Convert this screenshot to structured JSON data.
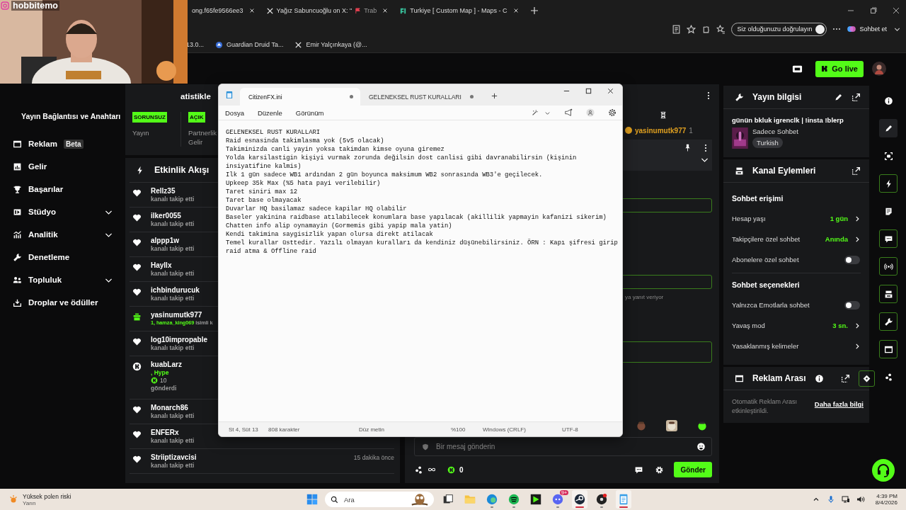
{
  "webcam": {
    "handle": "hobbitemo"
  },
  "browser": {
    "tabs": [
      {
        "title": "ong.f65fe9566ee3",
        "selected": false
      },
      {
        "title": "Yağız Sabuncuoğlu on X: \"",
        "title_end": "Trab",
        "selected": false
      },
      {
        "title": "Turkiye [ Custom Map ] - Maps - C",
        "selected": false
      }
    ],
    "verify": "Siz olduğunuzu doğrulayın",
    "copilot": "Sohbet et",
    "bookmarks": [
      "13.0...",
      "Guardian Druid Ta...",
      "Emir Yalçınkaya (@..."
    ]
  },
  "header": {
    "go_live": "Go live"
  },
  "sidebar": {
    "heading": "Yayın Bağlantısı ve Anahtarı",
    "items": [
      {
        "label": "Reklam",
        "badge": "Beta",
        "expandable": false
      },
      {
        "label": "Gelir",
        "expandable": false
      },
      {
        "label": "Başarılar",
        "expandable": false
      },
      {
        "label": "Stüdyo",
        "expandable": true
      },
      {
        "label": "Analitik",
        "expandable": true
      },
      {
        "label": "Denetleme",
        "expandable": false
      },
      {
        "label": "Topluluk",
        "expandable": true
      },
      {
        "label": "Droplar ve ödüller",
        "expandable": false
      }
    ]
  },
  "stats": {
    "title": "atistikle",
    "items": [
      {
        "badge": "SORUNSUZ",
        "label": "Yayın"
      },
      {
        "badge": "AÇIK",
        "label": "Partnerlik Gelir"
      }
    ]
  },
  "activity": {
    "title": "Etkinlik Akışı",
    "events": [
      {
        "kind": "follow",
        "user": "Rellz35",
        "detail": "kanalı takip etti"
      },
      {
        "kind": "follow",
        "user": "ilker0055",
        "detail": "kanalı takip etti"
      },
      {
        "kind": "follow",
        "user": "alppp1w",
        "detail": "kanalı takip etti"
      },
      {
        "kind": "follow",
        "user": "Hayllx",
        "detail": "kanalı takip etti"
      },
      {
        "kind": "follow",
        "user": "ichbindurucuk",
        "detail": "kanalı takip etti"
      },
      {
        "kind": "gift",
        "user": "yasinumutk977",
        "highlight": "1, hamza_king069",
        "detail": "isimli k"
      },
      {
        "kind": "follow",
        "user": "log10impropable",
        "detail": "kanalı takip etti"
      },
      {
        "kind": "kicks",
        "user": "kuabLarz",
        "highlight": ", Hype",
        "amount": "10",
        "detail": "gönderdi"
      },
      {
        "kind": "follow",
        "user": "Monarch86",
        "detail": "kanalı takip etti"
      },
      {
        "kind": "follow",
        "user": "ENFERx",
        "detail": "kanalı takip etti"
      },
      {
        "kind": "follow",
        "user": "Striiptizavcisi",
        "detail": "kanalı takip etti",
        "time": "15 dakika önce"
      }
    ]
  },
  "chat": {
    "pinned_user": "yasinumutk977",
    "pinned_count": "1",
    "typing": "ya yanıt veriyor",
    "placeholder": "Bir mesaj gönderin",
    "points": "0",
    "send": "Gönder"
  },
  "notepad": {
    "tabs": [
      {
        "title": "CitizenFX.ini",
        "selected": true,
        "unsaved": true
      },
      {
        "title": "GELENEKSEL RUST KURALLARI",
        "selected": false,
        "unsaved": true
      }
    ],
    "menus": [
      "Dosya",
      "Düzenle",
      "Görünüm"
    ],
    "lines": [
      "GELENEKSEL RUST KURALLARI",
      "Raid esnasinda takimlasma yok (5v5 olacak)",
      "Takiminizda canli yayin yoksa takimdan kimse oyuna giremez",
      "Yolda karsilastigin kişiyi vurmak zorunda değilsin dost canlisi gibi davranabilirsin (kişinin",
      "insiyatifine kalmis)",
      "Ilk 1 gün sadece WB1 ardından 2 gün boyunca maksimum WB2 sonrasında WB3'e geçilecek.",
      "Upkeep 35k Max (%5 hata payi verilebilir)",
      "Taret siniri max 12",
      "Taret base olmayacak",
      "Duvarlar HQ basilamaz sadece kapilar HQ olabilir",
      "Baseler yakinina raidbase atılabilecek konumlara base yapılacak (akillilik yapmayin kafanizi sikerim)",
      "Chatten info alip oynamayin (Gormemis gibi yapip mala yatin)",
      "Kendi takimina saygisizlik yapan olursa direkt atilacak",
      "Temel kurallar üsttedir. Yazılı olmayan kuralları da kendiniz düşünebilirsiniz. ÖRN : Kapı şifresi girip",
      "raid atma & Offline raid"
    ],
    "status": [
      "St 4, Süt 13",
      "808 karakter",
      "Düz metin",
      "%100",
      "Windows (CRLF)",
      "UTF-8"
    ]
  },
  "stream_info": {
    "title": "Yayın bilgisi",
    "stream_title": "günün bkluk igrenclk | !insta !blerp",
    "category": "Sadece Sohbet",
    "tag": "Turkish"
  },
  "channel_actions": {
    "title": "Kanal Eylemleri",
    "sections": [
      {
        "heading": "Sohbet erişimi",
        "rows": [
          {
            "kind": "value",
            "label": "Hesap yaşı",
            "value": "1 gün"
          },
          {
            "kind": "value",
            "label": "Takipçilere özel sohbet",
            "value": "Anında"
          },
          {
            "kind": "toggle",
            "label": "Abonelere özel sohbet",
            "on": false
          }
        ]
      },
      {
        "heading": "Sohbet seçenekleri",
        "rows": [
          {
            "kind": "toggle",
            "label": "Yalnızca Emotlarla sohbet",
            "on": false
          },
          {
            "kind": "value",
            "label": "Yavaş mod",
            "value": "3 sn."
          },
          {
            "kind": "link",
            "label": "Yasaklanmış kelimeler"
          }
        ]
      }
    ]
  },
  "ad_break": {
    "title": "Reklam Arası",
    "text": "Otomatik Reklam Arası etkinleştirildi.",
    "link": "Daha fazla bilgi"
  },
  "rail": {
    "icons": [
      {
        "selected": false,
        "pinned": false
      },
      {
        "selected": true,
        "pinned": false
      },
      {
        "selected": false,
        "pinned": false
      },
      {
        "selected": false,
        "pinned": true
      },
      {
        "selected": false,
        "pinned": false
      },
      {
        "selected": false,
        "pinned": true
      },
      {
        "selected": false,
        "pinned": true
      },
      {
        "selected": false,
        "pinned": true
      },
      {
        "selected": false,
        "pinned": true
      },
      {
        "selected": false,
        "pinned": true
      },
      {
        "selected": false,
        "pinned": false
      }
    ]
  },
  "taskbar": {
    "weather": "Yüksek polen riski",
    "weather_sub": "Yarın",
    "search": "Ara",
    "apps": [
      {
        "running": false,
        "selected": false
      },
      {
        "running": false,
        "selected": false
      },
      {
        "running": true,
        "selected": false
      },
      {
        "running": true,
        "selected": false
      },
      {
        "running": false,
        "selected": false
      },
      {
        "running": true,
        "selected": false,
        "badge": "9+"
      },
      {
        "running": true,
        "selected": true
      },
      {
        "running": true,
        "selected": false
      },
      {
        "running": true,
        "selected": true
      }
    ],
    "time": "4:39 PM",
    "date": "8/4/2026"
  }
}
